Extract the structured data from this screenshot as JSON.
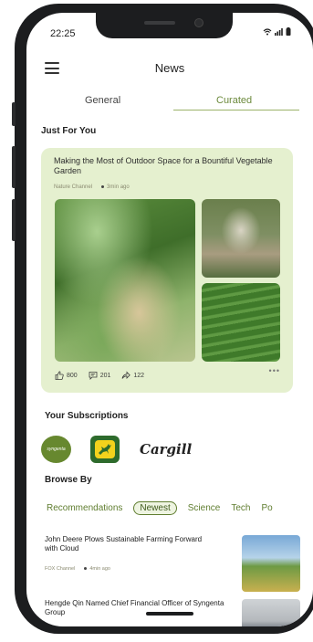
{
  "status_bar": {
    "time": "22:25"
  },
  "header": {
    "title": "News"
  },
  "tabs": [
    {
      "label": "General",
      "selected": false
    },
    {
      "label": "Curated",
      "selected": true
    }
  ],
  "for_you": {
    "heading": "Just For You",
    "card": {
      "title": "Making the Most of Outdoor Space for a Bountiful Vegetable Garden",
      "source": "Nature Channel",
      "time": "3min ago",
      "likes": "800",
      "comments": "201",
      "shares": "122",
      "more": "•••"
    }
  },
  "subscriptions": {
    "heading": "Your Subscriptions",
    "logos": [
      {
        "name": "syngenta",
        "label": "syngenta"
      },
      {
        "name": "john-deere",
        "label": ""
      },
      {
        "name": "cargill",
        "label": "Cargill"
      }
    ]
  },
  "browse": {
    "heading": "Browse By",
    "filters": [
      "Recommendations",
      "Newest",
      "Science",
      "Tech",
      "Po"
    ],
    "active_filter": "Newest"
  },
  "news": [
    {
      "title": "John Deere Plows Sustainable Farming Forward with Cloud",
      "source": "FOX Channel",
      "time": "4min ago"
    },
    {
      "title": "Hengde Qin Named Chief Financial Officer of Syngenta Group",
      "source": "",
      "time": ""
    }
  ],
  "colors": {
    "accent": "#6c8a3c",
    "card_bg": "#e5f0cf",
    "frame": "#1c1d1f"
  }
}
